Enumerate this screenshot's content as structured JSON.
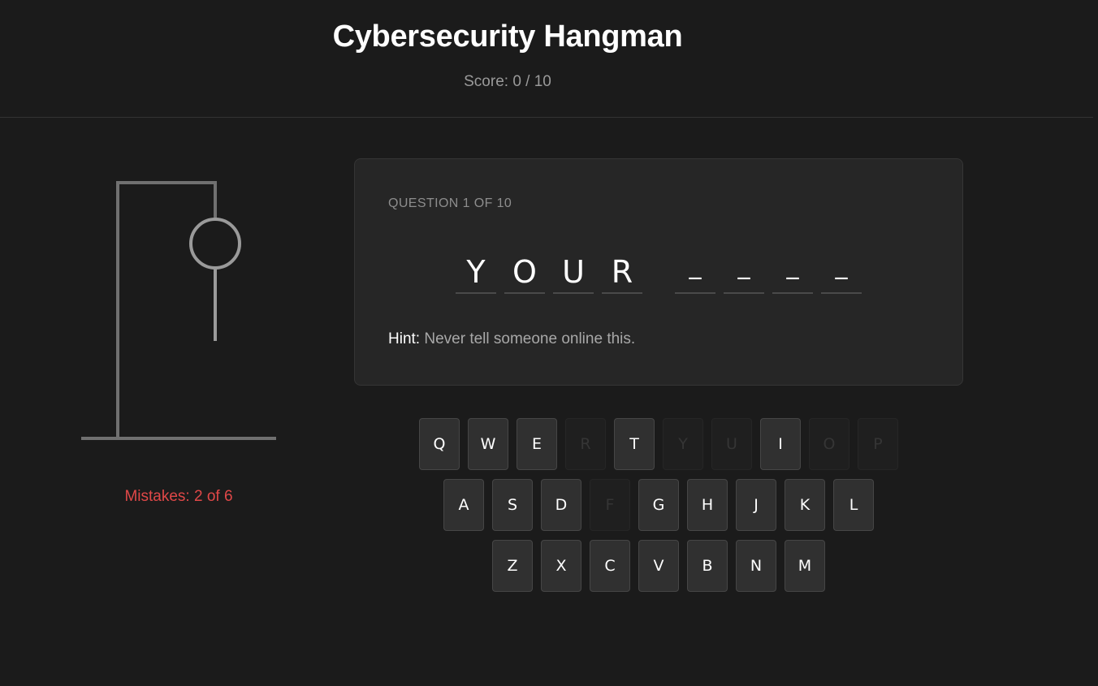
{
  "header": {
    "title": "Cybersecurity Hangman",
    "score": "Score: 0 / 10"
  },
  "hangman": {
    "mistakes_text": "Mistakes: 2 of 6",
    "mistakes": 2,
    "max_mistakes": 6,
    "mistakes_color": "#e04848"
  },
  "question": {
    "label": "QUESTION 1 OF 10",
    "word": [
      {
        "char": "Y",
        "revealed": true
      },
      {
        "char": "O",
        "revealed": true
      },
      {
        "char": "U",
        "revealed": true
      },
      {
        "char": "R",
        "revealed": true
      },
      {
        "char": " ",
        "space": true
      },
      {
        "char": "_",
        "revealed": false
      },
      {
        "char": "_",
        "revealed": false
      },
      {
        "char": "_",
        "revealed": false
      },
      {
        "char": "_",
        "revealed": false
      }
    ],
    "hint_label": "Hint:",
    "hint_text": "Never tell someone online this."
  },
  "keyboard": {
    "rows": [
      [
        {
          "letter": "Q",
          "used": false
        },
        {
          "letter": "W",
          "used": false
        },
        {
          "letter": "E",
          "used": false
        },
        {
          "letter": "R",
          "used": true
        },
        {
          "letter": "T",
          "used": false
        },
        {
          "letter": "Y",
          "used": true
        },
        {
          "letter": "U",
          "used": true
        },
        {
          "letter": "I",
          "used": false
        },
        {
          "letter": "O",
          "used": true
        },
        {
          "letter": "P",
          "used": true
        }
      ],
      [
        {
          "letter": "A",
          "used": false
        },
        {
          "letter": "S",
          "used": false
        },
        {
          "letter": "D",
          "used": false
        },
        {
          "letter": "F",
          "used": true
        },
        {
          "letter": "G",
          "used": false
        },
        {
          "letter": "H",
          "used": false
        },
        {
          "letter": "J",
          "used": false
        },
        {
          "letter": "K",
          "used": false
        },
        {
          "letter": "L",
          "used": false
        }
      ],
      [
        {
          "letter": "Z",
          "used": false
        },
        {
          "letter": "X",
          "used": false
        },
        {
          "letter": "C",
          "used": false
        },
        {
          "letter": "V",
          "used": false
        },
        {
          "letter": "B",
          "used": false
        },
        {
          "letter": "N",
          "used": false
        },
        {
          "letter": "M",
          "used": false
        }
      ]
    ]
  }
}
